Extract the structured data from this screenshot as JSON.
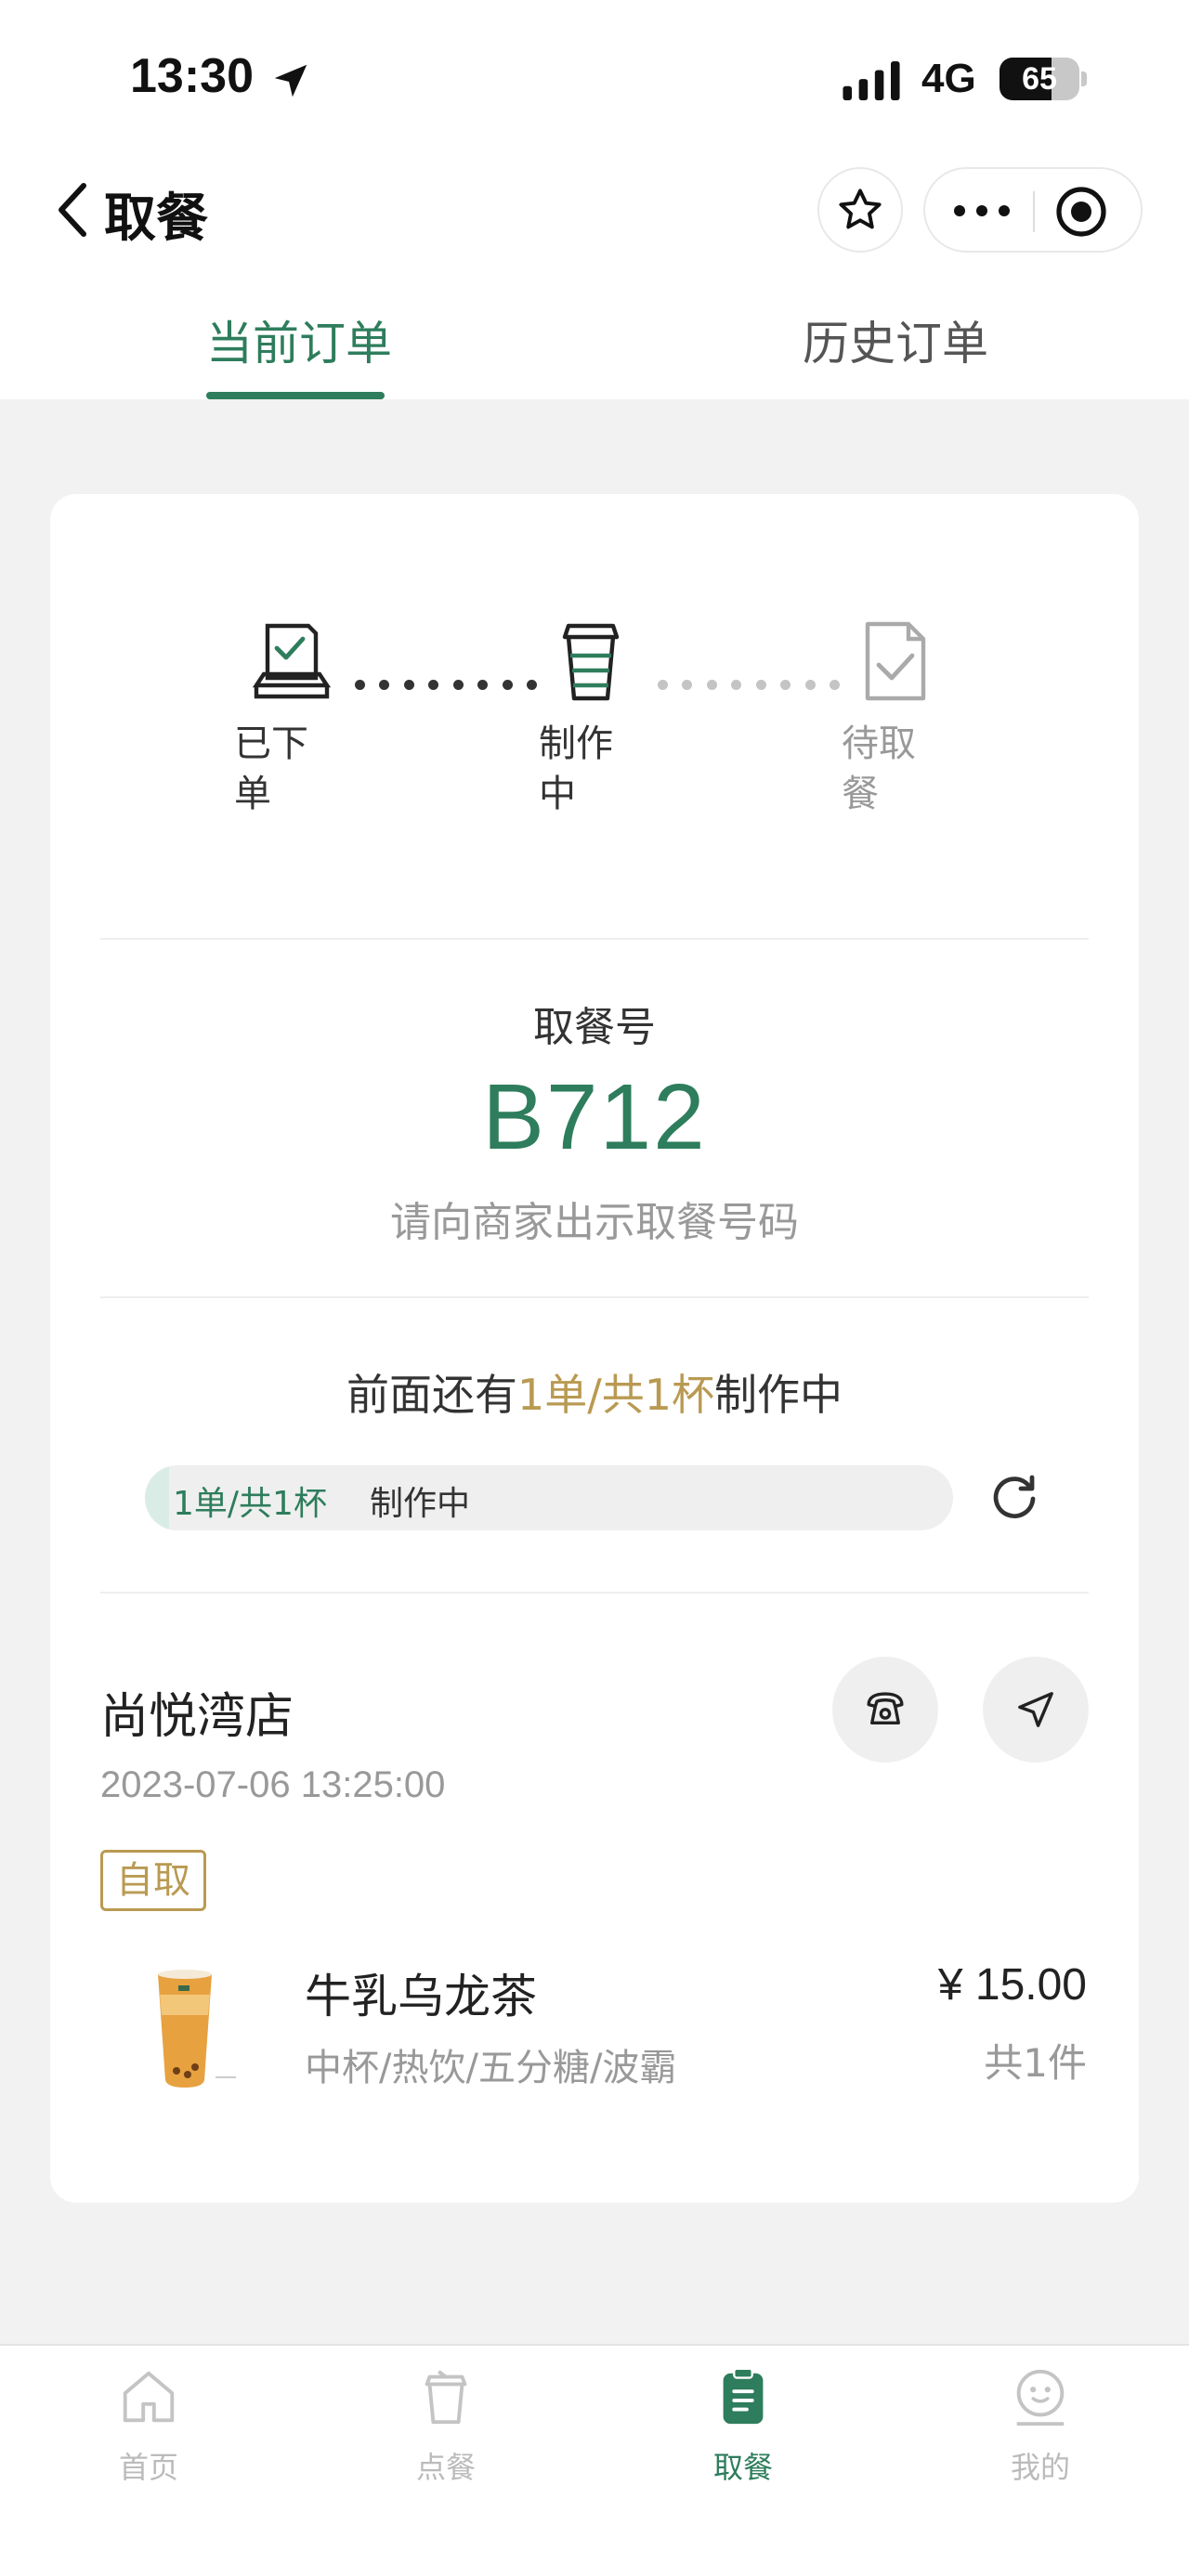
{
  "status_bar": {
    "time": "13:30",
    "network": "4G",
    "battery_percent": "65",
    "battery_level": 0.65
  },
  "nav": {
    "title": "取餐"
  },
  "tabs": {
    "current": "当前订单",
    "history": "历史订单",
    "selected": "current"
  },
  "progress_steps": [
    {
      "label": "已下单",
      "icon": "order-placed-icon",
      "state": "done"
    },
    {
      "label": "制作中",
      "icon": "cup-making-icon",
      "state": "active"
    },
    {
      "label": "待取餐",
      "icon": "pickup-waiting-icon",
      "state": "pending"
    }
  ],
  "pickup": {
    "label": "取餐号",
    "number": "B712",
    "hint": "请向商家出示取餐号码"
  },
  "queue": {
    "prefix": "前面还有",
    "highlight": "1单/共1杯",
    "suffix": "制作中",
    "bar_count": "1单/共1杯",
    "bar_status": "制作中",
    "bar_level": 0.03
  },
  "store": {
    "name": "尚悦湾店",
    "order_time": "2023-07-06 13:25:00",
    "pickup_tag": "自取"
  },
  "product": {
    "name": "牛乳乌龙茶",
    "spec": "中杯/热饮/五分糖/波霸",
    "price": "¥ 15.00",
    "qty": "共1件"
  },
  "bottom_tabs": [
    {
      "label": "首页",
      "icon": "home-icon",
      "active": false
    },
    {
      "label": "点餐",
      "icon": "cup-order-icon",
      "active": false
    },
    {
      "label": "取餐",
      "icon": "clipboard-icon",
      "active": true
    },
    {
      "label": "我的",
      "icon": "profile-face-icon",
      "active": false
    }
  ],
  "colors": {
    "accent": "#2e7d5c",
    "gold": "#b99a52",
    "inactive": "#bbbbbb",
    "background": "#f2f2f2"
  }
}
